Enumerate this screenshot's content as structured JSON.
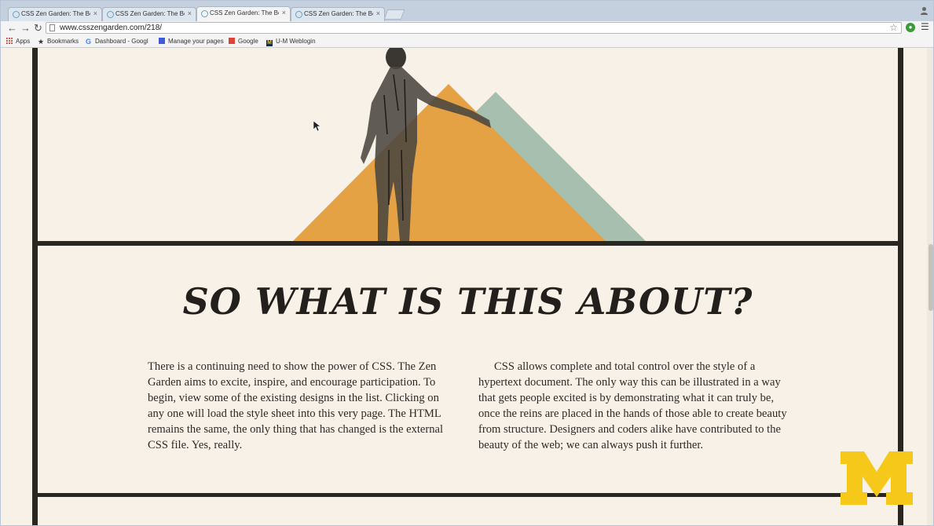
{
  "browser": {
    "tabs": [
      {
        "title": "CSS Zen Garden: The Beau",
        "active": false
      },
      {
        "title": "CSS Zen Garden: The Beau",
        "active": false
      },
      {
        "title": "CSS Zen Garden: The Beau",
        "active": true
      },
      {
        "title": "CSS Zen Garden: The Beau",
        "active": false
      }
    ],
    "url": "www.csszengarden.com/218/",
    "bookmarks": [
      "Apps",
      "Bookmarks",
      "Dashboard - Googl",
      "Manage your pages",
      "Google",
      "U-M Weblogin"
    ]
  },
  "page": {
    "heading": "SO WHAT IS THIS ABOUT?",
    "paragraph1": "There is a continuing need to show the power of CSS. The Zen Garden aims to excite, inspire, and encourage participation. To begin, view some of the existing designs in the list. Clicking on any one will load the style sheet into this very page. The HTML remains the same, the only thing that has changed is the external CSS file. Yes, really.",
    "paragraph2": "CSS allows complete and total control over the style of a hypertext document. The only way this can be illustrated in a way that gets people excited is by demonstrating what it can truly be, once the reins are placed in the hands of those able to create beauty from structure. Designers and coders alike have contributed to the beauty of the web; we can always push it further."
  },
  "colors": {
    "background": "#f8f1e7",
    "rule": "#2a2622",
    "orange_triangle": "#e4a244",
    "sage_triangle": "#a6bfae",
    "logo_maize": "#f6c81a"
  },
  "icons": [
    "favicon-icon",
    "close-icon",
    "back-icon",
    "forward-icon",
    "reload-icon",
    "page-icon",
    "star-icon",
    "extension-icon",
    "menu-icon",
    "apps-icon",
    "bookmark-star-icon",
    "google-icon",
    "block-m-icon",
    "cursor-icon",
    "profile-icon"
  ]
}
